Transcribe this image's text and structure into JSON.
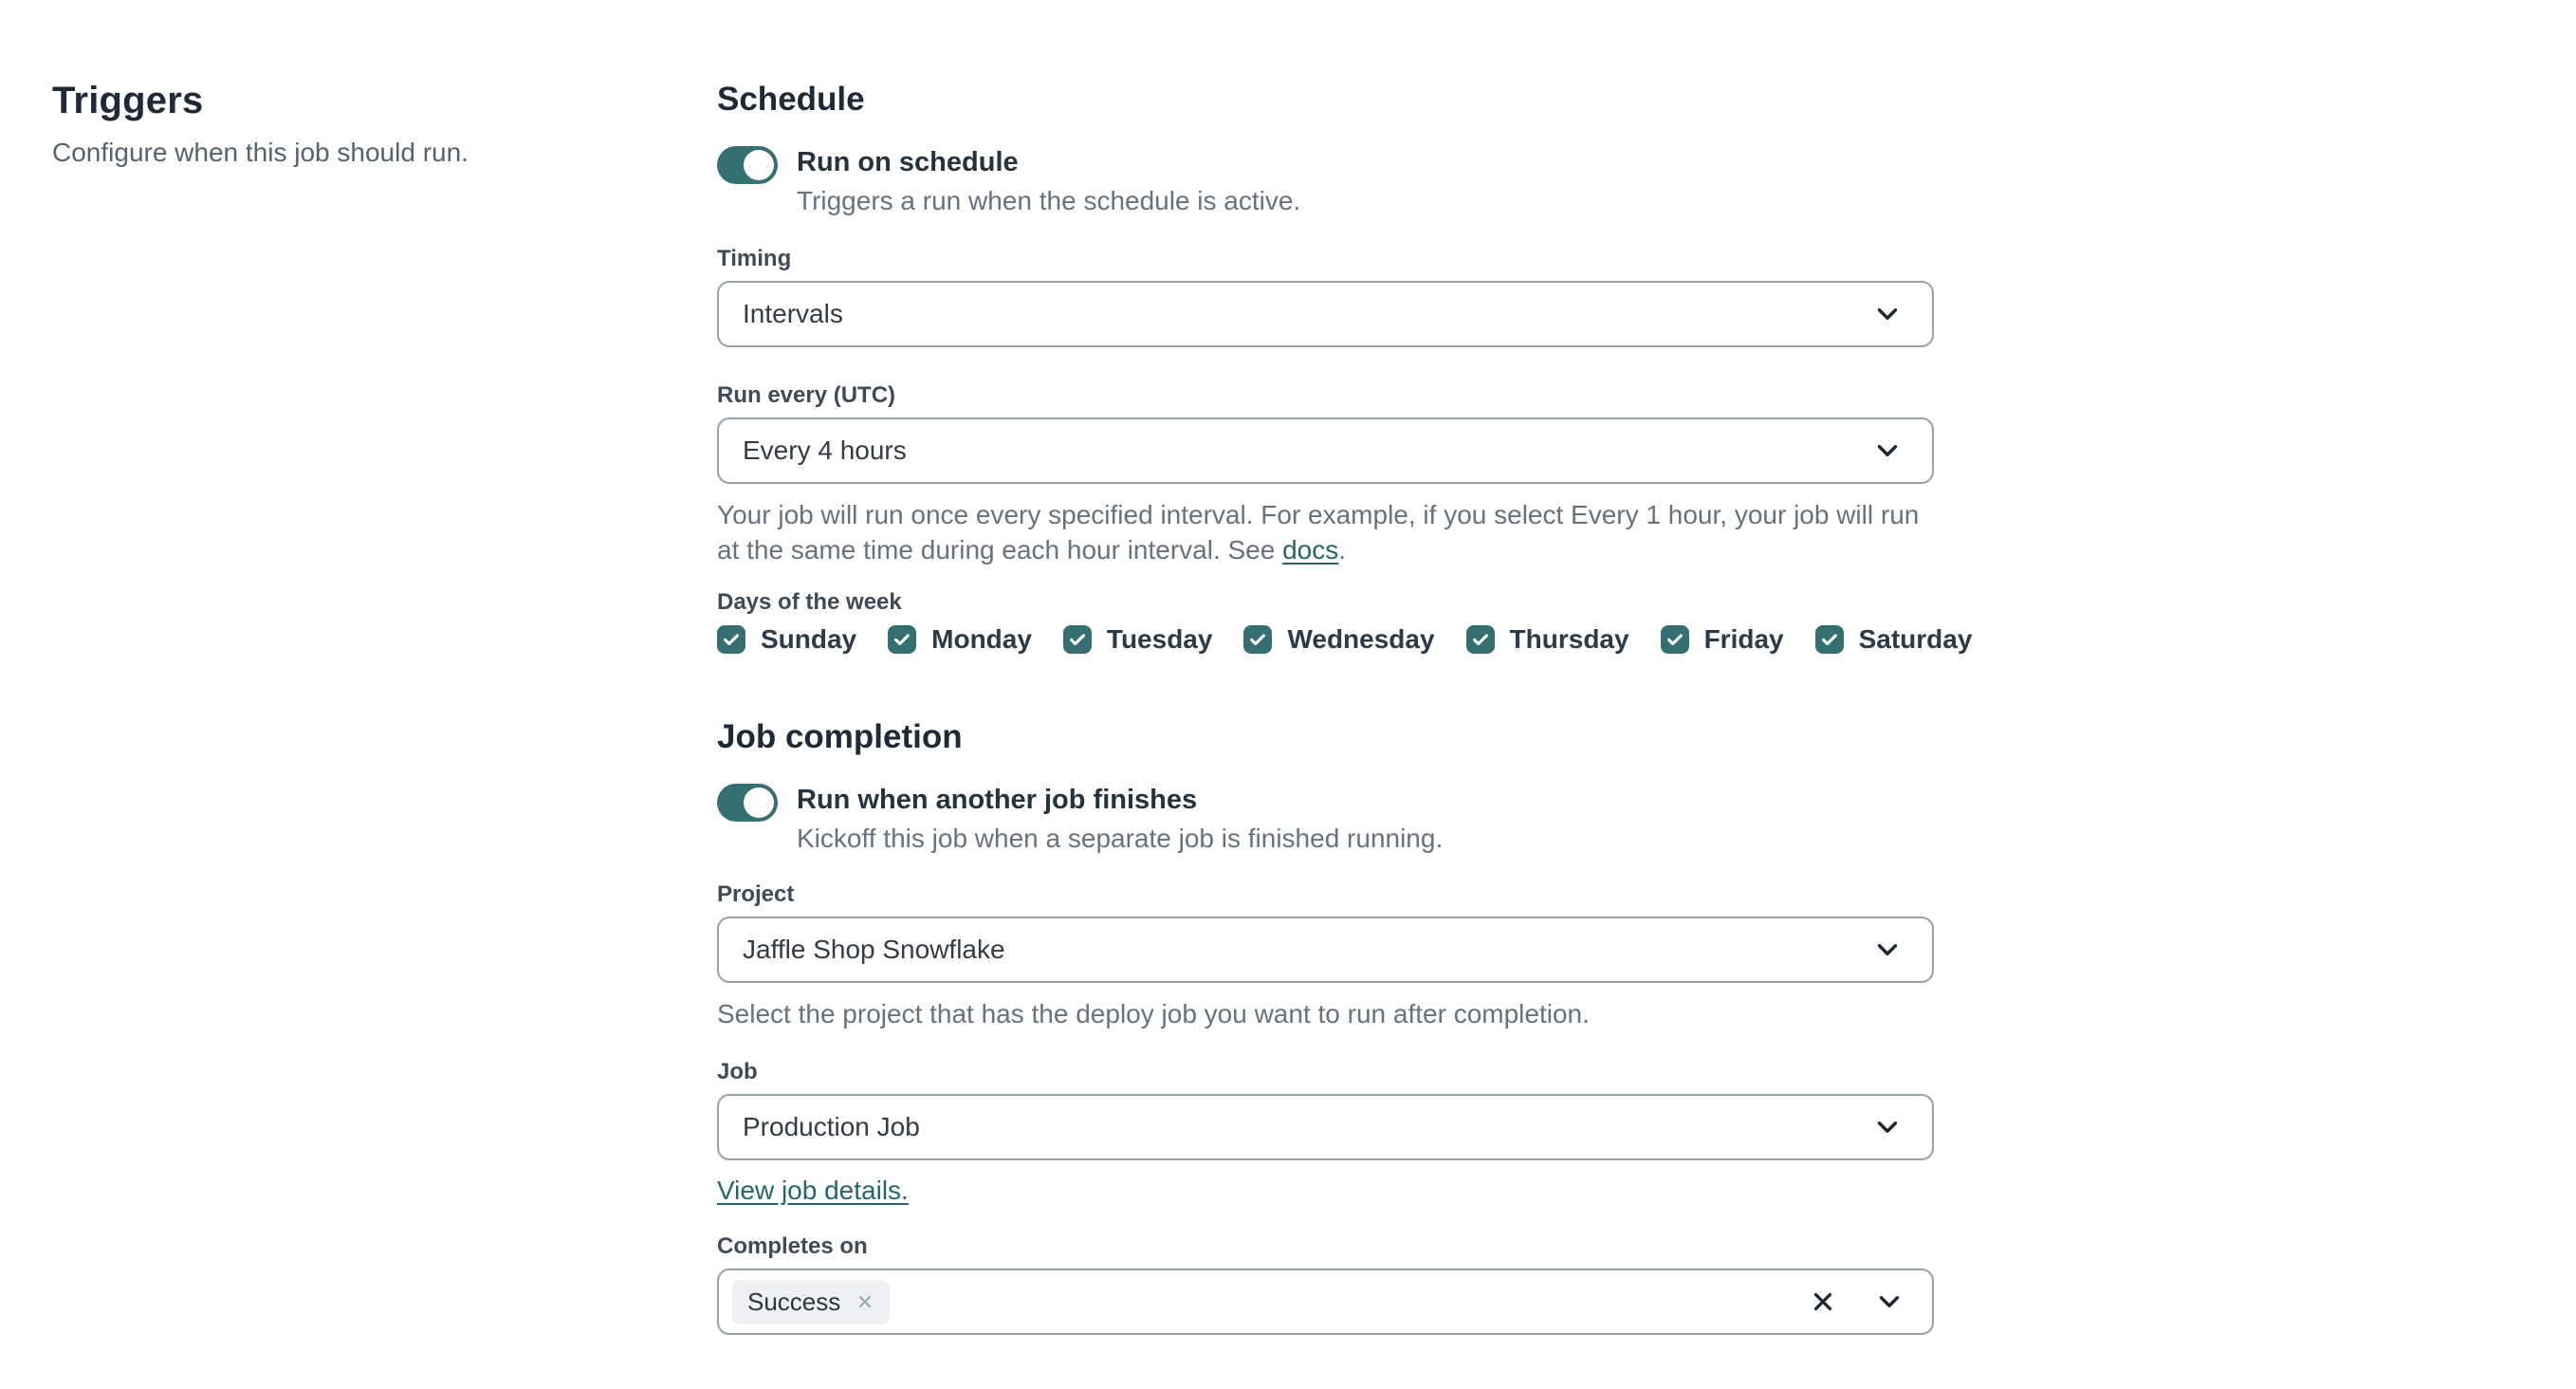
{
  "colors": {
    "teal": "#356f72",
    "link_teal": "#266569",
    "heading": "#1e2a38",
    "border": "#97a1aa",
    "tag_bg": "#eef0f3"
  },
  "sidebar": {
    "title": "Triggers",
    "subtitle": "Configure when this job should run."
  },
  "schedule": {
    "heading": "Schedule",
    "toggle": {
      "state": "on",
      "label": "Run on schedule",
      "description": "Triggers a run when the schedule is active."
    },
    "timing": {
      "label": "Timing",
      "value": "Intervals"
    },
    "run_every": {
      "label": "Run every (UTC)",
      "value": "Every 4 hours",
      "help_before_link": "Your job will run once every specified interval. For example, if you select Every 1 hour, your job will run at the same time during each hour interval. See ",
      "link_text": "docs",
      "help_after_link": "."
    },
    "days": {
      "label": "Days of the week",
      "items": [
        {
          "label": "Sunday",
          "checked": true
        },
        {
          "label": "Monday",
          "checked": true
        },
        {
          "label": "Tuesday",
          "checked": true
        },
        {
          "label": "Wednesday",
          "checked": true
        },
        {
          "label": "Thursday",
          "checked": true
        },
        {
          "label": "Friday",
          "checked": true
        },
        {
          "label": "Saturday",
          "checked": true
        }
      ]
    }
  },
  "job_completion": {
    "heading": "Job completion",
    "toggle": {
      "state": "on",
      "label": "Run when another job finishes",
      "description": "Kickoff this job when a separate job is finished running."
    },
    "project": {
      "label": "Project",
      "value": "Jaffle Shop Snowflake",
      "help": "Select the project that has the deploy job you want to run after completion."
    },
    "job": {
      "label": "Job",
      "value": "Production Job",
      "link_text": "View job details."
    },
    "completes_on": {
      "label": "Completes on",
      "tags": [
        {
          "label": "Success"
        }
      ]
    }
  }
}
